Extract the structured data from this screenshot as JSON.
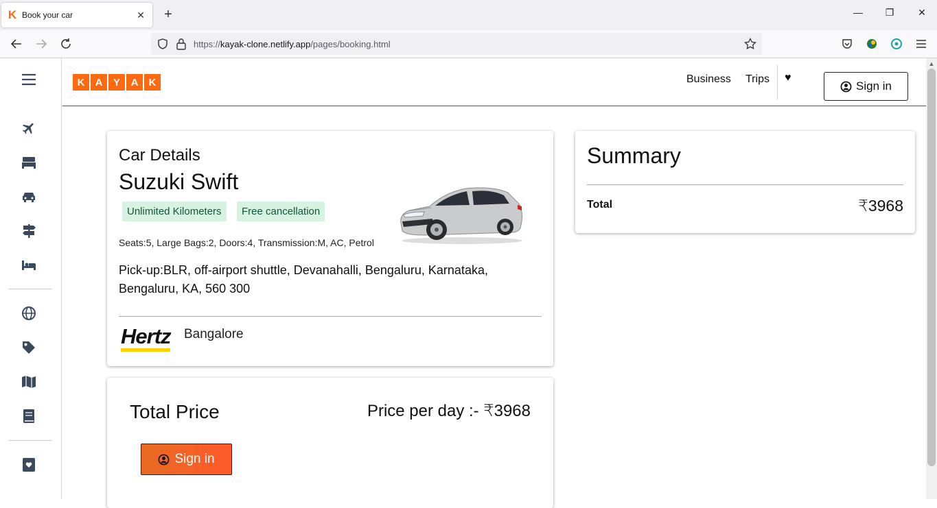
{
  "browser": {
    "tab_title": "Book your car",
    "tab_favicon": "K",
    "url_prefix": "https://",
    "url_host": "kayak-clone.netlify.app",
    "url_path": "/pages/booking.html"
  },
  "sidebar": {
    "items": [
      {
        "icon": "menu-icon"
      },
      {
        "icon": "plane-icon"
      },
      {
        "icon": "bed-icon"
      },
      {
        "icon": "car-icon"
      },
      {
        "icon": "signpost-icon"
      },
      {
        "icon": "hotel-bed-icon"
      },
      {
        "icon": "globe-icon"
      },
      {
        "icon": "tag-icon"
      },
      {
        "icon": "map-icon"
      },
      {
        "icon": "book-icon"
      },
      {
        "icon": "saved-heart-icon"
      }
    ]
  },
  "header": {
    "logo_letters": [
      "K",
      "A",
      "Y",
      "A",
      "K"
    ],
    "business": "Business",
    "trips": "Trips",
    "heart": "♥",
    "signin": "Sign in"
  },
  "car": {
    "heading": "Car Details",
    "name": "Suzuki Swift",
    "badges": [
      "Unlimited Kilometers",
      "Free cancellation"
    ],
    "specs": "Seats:5, Large Bags:2, Doors:4, Transmission:M, AC, Petrol",
    "pickup": "Pick-up:BLR, off-airport shuttle, Devanahalli, Bengaluru, Karnataka, Bengaluru, KA, 560 300",
    "vendor_logo": "Hertz",
    "location": "Bangalore"
  },
  "summary": {
    "title": "Summary",
    "total_label": "Total",
    "total_value": "₹3968"
  },
  "price": {
    "title": "Total Price",
    "per_day": "Price per day :- ₹3968",
    "signin": "Sign in"
  },
  "colors": {
    "brand": "#ff690f",
    "badge_bg": "#d7f2e1",
    "badge_text": "#12553a",
    "sidebar_icon": "#3a4a5c"
  }
}
